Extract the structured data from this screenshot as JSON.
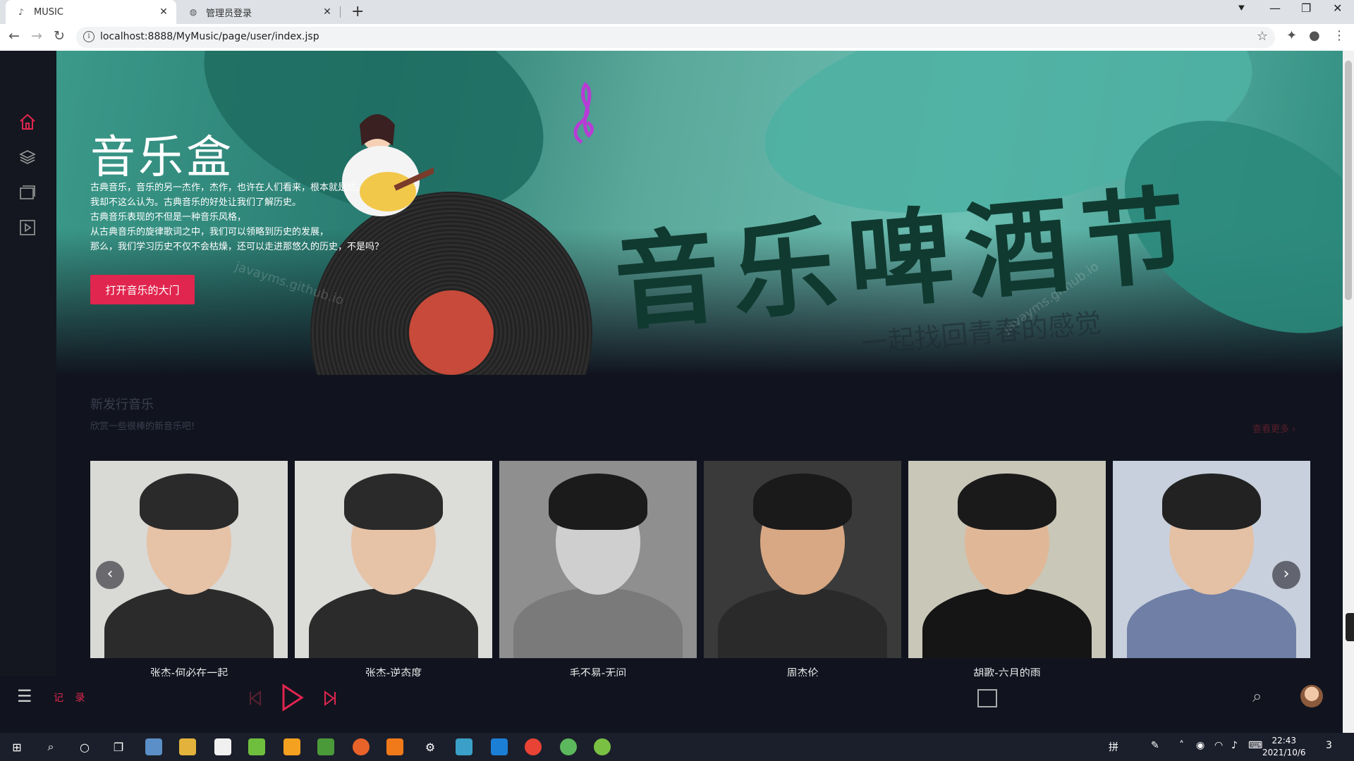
{
  "browser": {
    "tabs": [
      {
        "title": "MUSIC",
        "active": true
      },
      {
        "title": "管理员登录",
        "active": false
      }
    ],
    "new_tab_label": "+",
    "url": "localhost:8888/MyMusic/page/user/index.jsp",
    "info_label": "i"
  },
  "banner": {
    "title": "音乐盒",
    "lines": [
      "古典音乐，音乐的另一杰作，杰作，也许在人们看来，根本就是烂。",
      "我却不这么认为。古典音乐的好处让我们了解历史。",
      "古典音乐表现的不但是一种音乐风格，",
      "从古典音乐的旋律歌词之中，我们可以领略到历史的发展，",
      "那么，我们学习历史不仅不会枯燥，还可以走进那悠久的历史，不是吗？"
    ],
    "cta_label": "打开音乐的大门",
    "festival_text": "音乐啤酒节",
    "festival_sub": "一起找回青春的感觉",
    "watermark": "javayms.github.io"
  },
  "section": {
    "title": "新发行音乐",
    "subtitle": "欣赏一些很棒的新音乐吧!",
    "more_label": "查看更多 ›"
  },
  "cards": [
    {
      "name": "张杰-何必在一起",
      "skin": "#e6c2a6",
      "hair": "#2a2a2a",
      "body": "#2b2b2b",
      "bg": "#d9d9d6"
    },
    {
      "name": "张杰-逆态度",
      "skin": "#e6c2a6",
      "hair": "#2a2a2a",
      "body": "#2b2b2b",
      "bg": "#dcdcd9"
    },
    {
      "name": "毛不易-无问",
      "skin": "#cfcfcf",
      "hair": "#1b1b1b",
      "body": "#7a7a7a",
      "bg": "#8f8f8f"
    },
    {
      "name": "周杰伦",
      "skin": "#d8a884",
      "hair": "#1a1a1a",
      "body": "#2a2a2a",
      "bg": "#3a3a3a"
    },
    {
      "name": "胡歌-六月的雨",
      "skin": "#e0b898",
      "hair": "#1a1a1a",
      "body": "#151515",
      "bg": "#c9c7b8"
    },
    {
      "name": "",
      "skin": "#e4c0a4",
      "hair": "#222",
      "body": "#6f7fa6",
      "bg": "#c8d0dd"
    }
  ],
  "player": {
    "record_label": "记 录"
  },
  "taskbar": {
    "time": "22:43",
    "date": "2021/10/6",
    "notification_count": "3"
  },
  "colors": {
    "accent": "#e0254e",
    "page_bg": "#11141f"
  }
}
